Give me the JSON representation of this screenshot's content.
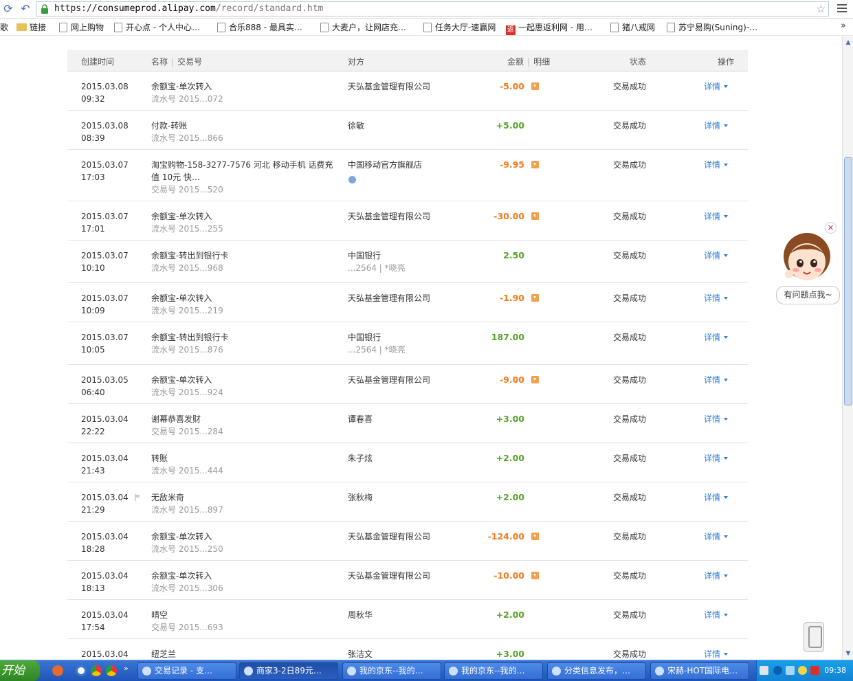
{
  "browser": {
    "url_scheme": "https://",
    "url_host": "consumeprod.alipay.com",
    "url_path": "/record/standard.htm",
    "bookmarks": [
      {
        "label": "歌",
        "kind": "none"
      },
      {
        "label": "链接",
        "kind": "folder"
      },
      {
        "label": "网上购物",
        "kind": "page"
      },
      {
        "label": "开心点 - 个人中心…",
        "kind": "page"
      },
      {
        "label": "合乐888 - 最具实…",
        "kind": "page"
      },
      {
        "label": "大麦户，让网店充…",
        "kind": "page"
      },
      {
        "label": "任务大厅-速赢网",
        "kind": "page"
      },
      {
        "label": "一起惠返利网 - 用…",
        "kind": "red",
        "badge": "返"
      },
      {
        "label": "猪八戒网",
        "kind": "page"
      },
      {
        "label": "苏宁易购(Suning)-…",
        "kind": "page"
      }
    ],
    "bookmarks_more": "»"
  },
  "table": {
    "headers": {
      "time": "创建时间",
      "name": "名称",
      "trade_no": "交易号",
      "party": "对方",
      "amount": "金额",
      "detail": "明细",
      "status": "状态",
      "op": "操作"
    },
    "rows": [
      {
        "date": "2015.03.08",
        "time": "09:32",
        "name": "余额宝-单次转入",
        "ref": "流水号 2015...072",
        "party": "天弘基金管理有限公司",
        "amount": "-5.00",
        "sign": "neg",
        "detail_icon": true,
        "status": "交易成功",
        "op": "详情"
      },
      {
        "date": "2015.03.08",
        "time": "08:39",
        "name": "付款-转账",
        "ref": "流水号 2015...866",
        "party": "徐敏",
        "amount": "+5.00",
        "sign": "pos",
        "detail_icon": false,
        "status": "交易成功",
        "op": "详情"
      },
      {
        "date": "2015.03.07",
        "time": "17:03",
        "name": "淘宝购物-158-3277-7576 河北 移动手机 话费充值 10元 快…",
        "ref": "交易号 2015...520",
        "party": "中国移动官方旗舰店",
        "party_icon": "clock",
        "amount": "-9.95",
        "sign": "neg",
        "detail_icon": true,
        "status": "交易成功",
        "op": "详情"
      },
      {
        "date": "2015.03.07",
        "time": "17:01",
        "name": "余额宝-单次转入",
        "ref": "流水号 2015...255",
        "party": "天弘基金管理有限公司",
        "amount": "-30.00",
        "sign": "neg",
        "detail_icon": true,
        "status": "交易成功",
        "op": "详情"
      },
      {
        "date": "2015.03.07",
        "time": "10:10",
        "name": "余额宝-转出到银行卡",
        "ref": "流水号 2015...968",
        "party": "中国银行",
        "party_sub": "...2564 | *晓亮",
        "amount": "2.50",
        "sign": "cash",
        "detail_icon": false,
        "status": "交易成功",
        "op": "详情"
      },
      {
        "date": "2015.03.07",
        "time": "10:09",
        "name": "余额宝-单次转入",
        "ref": "流水号 2015...219",
        "party": "天弘基金管理有限公司",
        "amount": "-1.90",
        "sign": "neg",
        "detail_icon": true,
        "status": "交易成功",
        "op": "详情"
      },
      {
        "date": "2015.03.07",
        "time": "10:05",
        "name": "余额宝-转出到银行卡",
        "ref": "流水号 2015...876",
        "party": "中国银行",
        "party_sub": "...2564 | *晓亮",
        "amount": "187.00",
        "sign": "cash",
        "detail_icon": false,
        "status": "交易成功",
        "op": "详情"
      },
      {
        "date": "2015.03.05",
        "time": "06:40",
        "name": "余额宝-单次转入",
        "ref": "流水号 2015...924",
        "party": "天弘基金管理有限公司",
        "amount": "-9.00",
        "sign": "neg",
        "detail_icon": true,
        "status": "交易成功",
        "op": "详情"
      },
      {
        "date": "2015.03.04",
        "time": "22:22",
        "name": "谢幕恭喜发财",
        "ref": "交易号 2015...284",
        "party": "谭春喜",
        "amount": "+3.00",
        "sign": "pos",
        "detail_icon": false,
        "status": "交易成功",
        "op": "详情"
      },
      {
        "date": "2015.03.04",
        "time": "21:43",
        "name": "转账",
        "ref": "流水号 2015...444",
        "party": "朱子炫",
        "amount": "+2.00",
        "sign": "pos",
        "detail_icon": false,
        "status": "交易成功",
        "op": "详情"
      },
      {
        "date": "2015.03.04",
        "time": "21:29",
        "name": "无敌米奇",
        "ref": "流水号 2015...897",
        "party": "张秋梅",
        "amount": "+2.00",
        "sign": "pos",
        "detail_icon": false,
        "flag": true,
        "status": "交易成功",
        "op": "详情"
      },
      {
        "date": "2015.03.04",
        "time": "18:28",
        "name": "余额宝-单次转入",
        "ref": "流水号 2015...250",
        "party": "天弘基金管理有限公司",
        "amount": "-124.00",
        "sign": "neg",
        "detail_icon": true,
        "status": "交易成功",
        "op": "详情"
      },
      {
        "date": "2015.03.04",
        "time": "18:13",
        "name": "余额宝-单次转入",
        "ref": "流水号 2015...306",
        "party": "天弘基金管理有限公司",
        "amount": "-10.00",
        "sign": "neg",
        "detail_icon": true,
        "status": "交易成功",
        "op": "详情"
      },
      {
        "date": "2015.03.04",
        "time": "17:54",
        "name": "晴空",
        "ref": "交易号 2015...693",
        "party": "周秋华",
        "amount": "+2.00",
        "sign": "pos",
        "detail_icon": false,
        "status": "交易成功",
        "op": "详情"
      },
      {
        "date": "2015.03.04",
        "time": "",
        "name": "纽芝兰",
        "ref": "",
        "party": "张洁文",
        "amount": "+3.00",
        "sign": "pos",
        "detail_icon": false,
        "status": "交易成功",
        "op": "详情"
      }
    ]
  },
  "helper": {
    "bubble": "有问题点我~",
    "close": "×"
  },
  "colors": {
    "negative": "#f27a1a",
    "positive": "#56a329",
    "link": "#2d7ed6",
    "header_bg": "#f2f2f2"
  },
  "taskbar": {
    "start": "开始",
    "tasks": [
      {
        "label": "交易记录 - 支…",
        "active": false
      },
      {
        "label": "商家3-2日89元…",
        "active": true
      },
      {
        "label": "我的京东--我的…",
        "active": false
      },
      {
        "label": "我的京东--我的…",
        "active": false
      },
      {
        "label": "分类信息发布，…",
        "active": false
      },
      {
        "label": "宋赫-HOT国际电…",
        "active": false
      }
    ],
    "clock": "09:38"
  }
}
